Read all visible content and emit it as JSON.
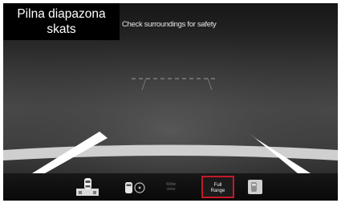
{
  "caption": {
    "line1": "Pilna diapazona",
    "line2": "skats"
  },
  "camera_view": {
    "warning_text": "Check surroundings for safety"
  },
  "toolbar": {
    "buttons": [
      {
        "name": "Top view",
        "icon": "car-top-view-icon"
      },
      {
        "name": "Rear side view",
        "icon": "car-rear-side-icon"
      },
      {
        "label_line1": "Wide",
        "label_line2": "view"
      },
      {
        "label_line1": "Full",
        "label_line2": "Range",
        "selected": true
      },
      {
        "name": "Parking assist",
        "icon": "parking-assist-icon"
      }
    ]
  },
  "colors": {
    "selected_border": "#c4182a",
    "guide_lines": "#ffffff"
  }
}
